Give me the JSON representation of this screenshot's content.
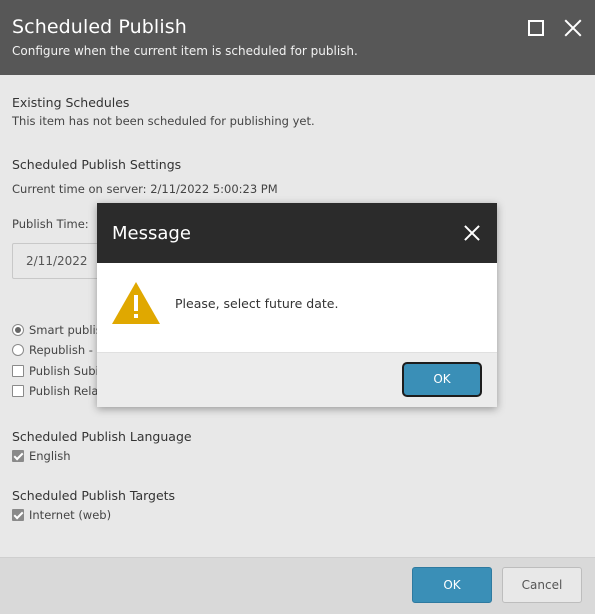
{
  "dialog": {
    "title": "Scheduled Publish",
    "subtitle": "Configure when the current item is scheduled for publish."
  },
  "existing": {
    "heading": "Existing Schedules",
    "text": "This item has not been scheduled for publishing yet."
  },
  "settings": {
    "heading": "Scheduled Publish Settings",
    "server_time": "Current time on server: 2/11/2022 5:00:23 PM",
    "publish_time_label": "Publish Time:",
    "date_value": "2/11/2022"
  },
  "options": {
    "smart_publish": "Smart publis",
    "republish": "Republish - F",
    "publish_subitems": "Publish Subi",
    "publish_related": "Publish Rela"
  },
  "language": {
    "heading": "Scheduled Publish Language",
    "english": "English"
  },
  "targets": {
    "heading": "Scheduled Publish Targets",
    "internet": "Internet (web)"
  },
  "footer": {
    "ok": "OK",
    "cancel": "Cancel"
  },
  "message": {
    "title": "Message",
    "text": "Please, select future date.",
    "ok": "OK",
    "icon": "warning-icon"
  },
  "colors": {
    "header_bg": "#575757",
    "modal_header_bg": "#2b2b2b",
    "primary_button": "#3a8fb7",
    "warning": "#e0a800"
  }
}
